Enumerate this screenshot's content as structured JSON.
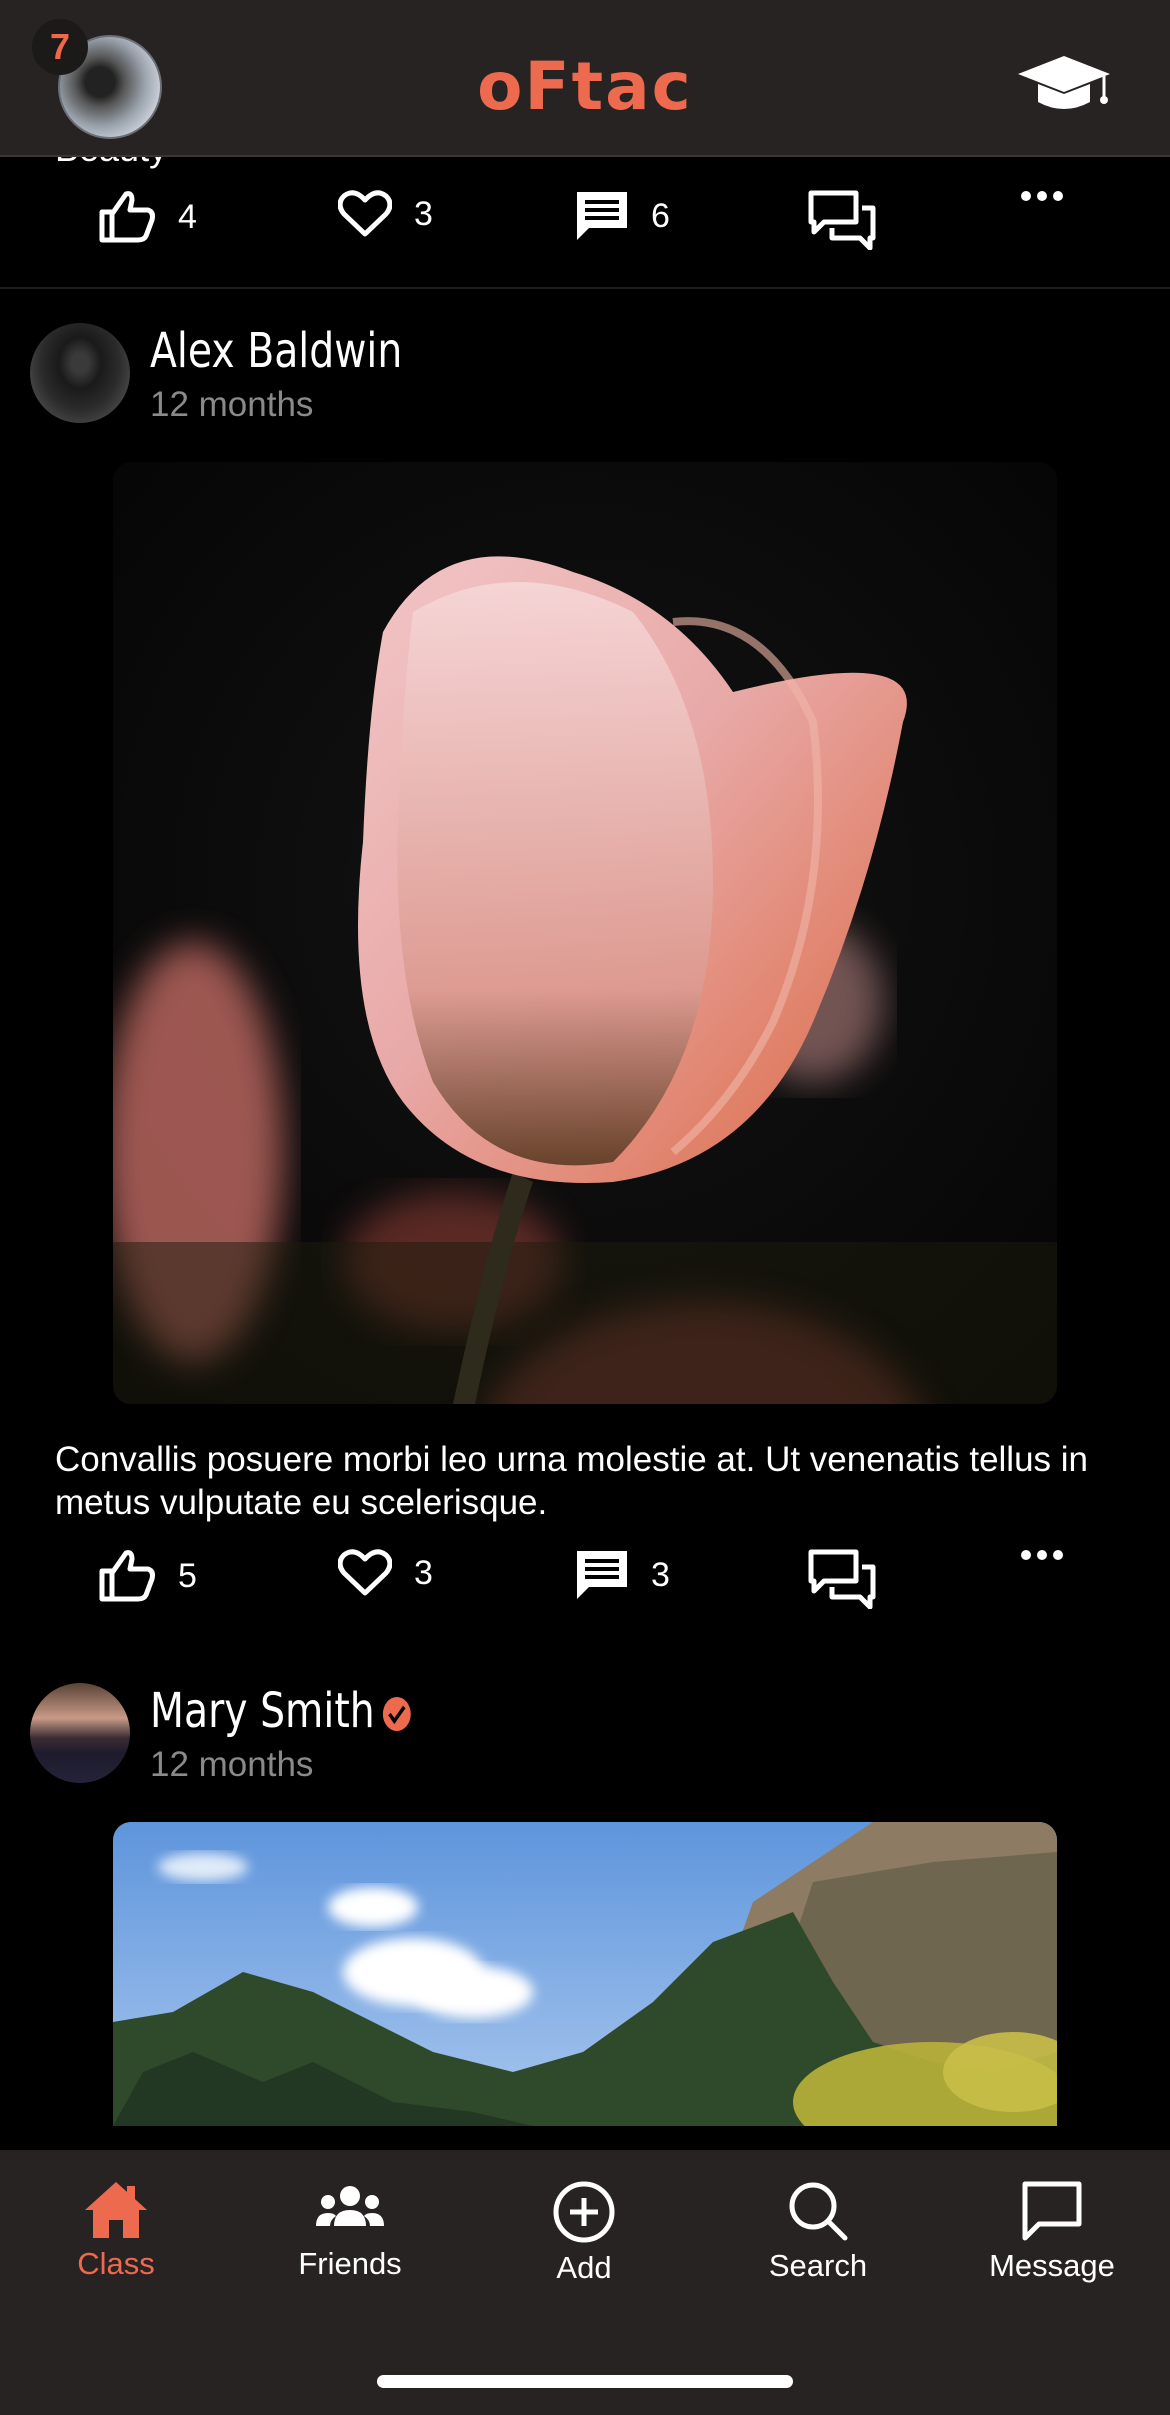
{
  "app": {
    "logo": "oFtac",
    "notification_count": "7",
    "accent": "#ee6a4e"
  },
  "feed": {
    "clipped_post": {
      "caption_partial": "Beauty",
      "likes": "4",
      "hearts": "3",
      "comments": "6"
    },
    "posts": [
      {
        "author": "Alex Baldwin",
        "time": "12 months",
        "verified": false,
        "image": "pink-tulip-photo",
        "caption": "Convallis posuere morbi leo urna molestie at. Ut venenatis tellus in metus vulputate eu scelerisque.",
        "likes": "5",
        "hearts": "3",
        "comments": "3"
      },
      {
        "author": "Mary Smith",
        "time": "12 months",
        "verified": true,
        "image": "mountain-forest-photo"
      }
    ]
  },
  "nav": {
    "items": [
      {
        "label": "Class",
        "icon": "home-icon",
        "active": true
      },
      {
        "label": "Friends",
        "icon": "friends-icon",
        "active": false
      },
      {
        "label": "Add",
        "icon": "add-circle-icon",
        "active": false
      },
      {
        "label": "Search",
        "icon": "search-icon",
        "active": false
      },
      {
        "label": "Message",
        "icon": "message-icon",
        "active": false
      }
    ]
  }
}
